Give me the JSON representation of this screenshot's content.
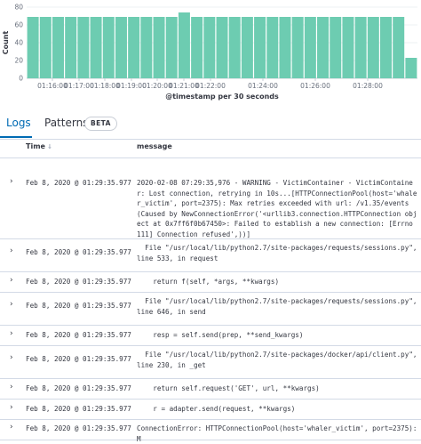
{
  "chart_data": {
    "type": "bar",
    "xlabel": "@timestamp per 30 seconds",
    "ylabel": "Count",
    "ylim": [
      0,
      80
    ],
    "yticks": [
      0,
      20,
      40,
      60,
      80
    ],
    "xtick_labels": [
      "01:16:00",
      "01:17:00",
      "01:18:00",
      "01:19:00",
      "01:20:00",
      "01:21:00",
      "01:22:00",
      "01:24:00",
      "01:26:00",
      "01:28:00"
    ],
    "values": [
      69,
      69,
      69,
      69,
      69,
      69,
      69,
      69,
      69,
      69,
      69,
      69,
      74,
      69,
      69,
      69,
      69,
      69,
      69,
      69,
      69,
      69,
      69,
      69,
      69,
      69,
      69,
      69,
      69,
      69,
      23
    ],
    "bar_color": "#6dccb1"
  },
  "tabs": {
    "logs": "Logs",
    "patterns": "Patterns",
    "badge": "BETA"
  },
  "table": {
    "time_header": "Time",
    "sort_indicator": "↓",
    "message_header": "message",
    "rows": [
      {
        "time": "Feb 8, 2020 @ 01:29:35.977",
        "message": "2020-02-08 07:29:35,976 - WARNING - VictimContainer - VictimContainer: Lost connection, retrying in 10s...[HTTPConnectionPool(host='whaler_victim', port=2375): Max retries exceeded with url: /v1.35/events (Caused by NewConnectionError('<urllib3.connection.HTTPConnection object at 0x7ff6f0b67450>: Failed to establish a new connection: [Errno 111] Connection refused',))]"
      },
      {
        "time": "Feb 8, 2020 @ 01:29:35.977",
        "message": "  File \"/usr/local/lib/python2.7/site-packages/requests/sessions.py\", line 533, in request"
      },
      {
        "time": "Feb 8, 2020 @ 01:29:35.977",
        "message": "    return f(self, *args, **kwargs)"
      },
      {
        "time": "Feb 8, 2020 @ 01:29:35.977",
        "message": "  File \"/usr/local/lib/python2.7/site-packages/requests/sessions.py\", line 646, in send"
      },
      {
        "time": "Feb 8, 2020 @ 01:29:35.977",
        "message": "    resp = self.send(prep, **send_kwargs)"
      },
      {
        "time": "Feb 8, 2020 @ 01:29:35.977",
        "message": "  File \"/usr/local/lib/python2.7/site-packages/docker/api/client.py\", line 230, in _get"
      },
      {
        "time": "Feb 8, 2020 @ 01:29:35.977",
        "message": "    return self.request('GET', url, **kwargs)"
      },
      {
        "time": "Feb 8, 2020 @ 01:29:35.977",
        "message": "    r = adapter.send(request, **kwargs)"
      },
      {
        "time": "Feb 8, 2020 @ 01:29:35.977",
        "message": "ConnectionError: HTTPConnectionPool(host='whaler_victim', port=2375): M"
      }
    ]
  }
}
